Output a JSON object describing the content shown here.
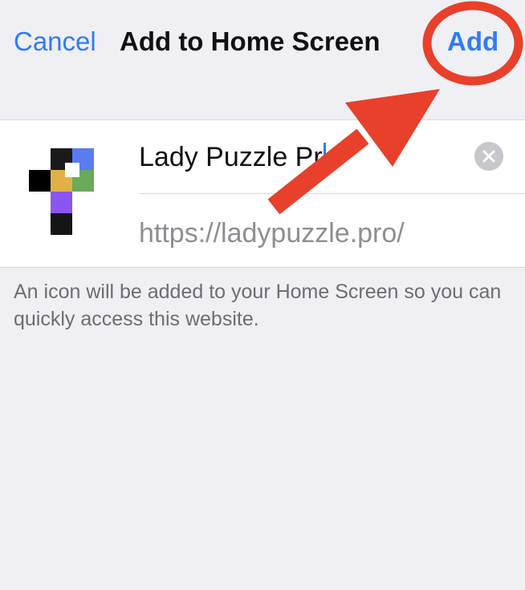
{
  "nav": {
    "cancel_label": "Cancel",
    "title": "Add to Home Screen",
    "add_label": "Add"
  },
  "form": {
    "name_value": "Lady Puzzle Pr",
    "url": "https://ladypuzzle.pro/",
    "clear_icon": "clear-x-icon"
  },
  "info_text": "An icon will be added to your Home Screen so you can quickly access this website.",
  "colors": {
    "accent": "#2f7cf6",
    "background": "#efeff4",
    "annotation_red": "#e8402a"
  },
  "app_icon": {
    "name": "lady-puzzle-app-icon"
  }
}
